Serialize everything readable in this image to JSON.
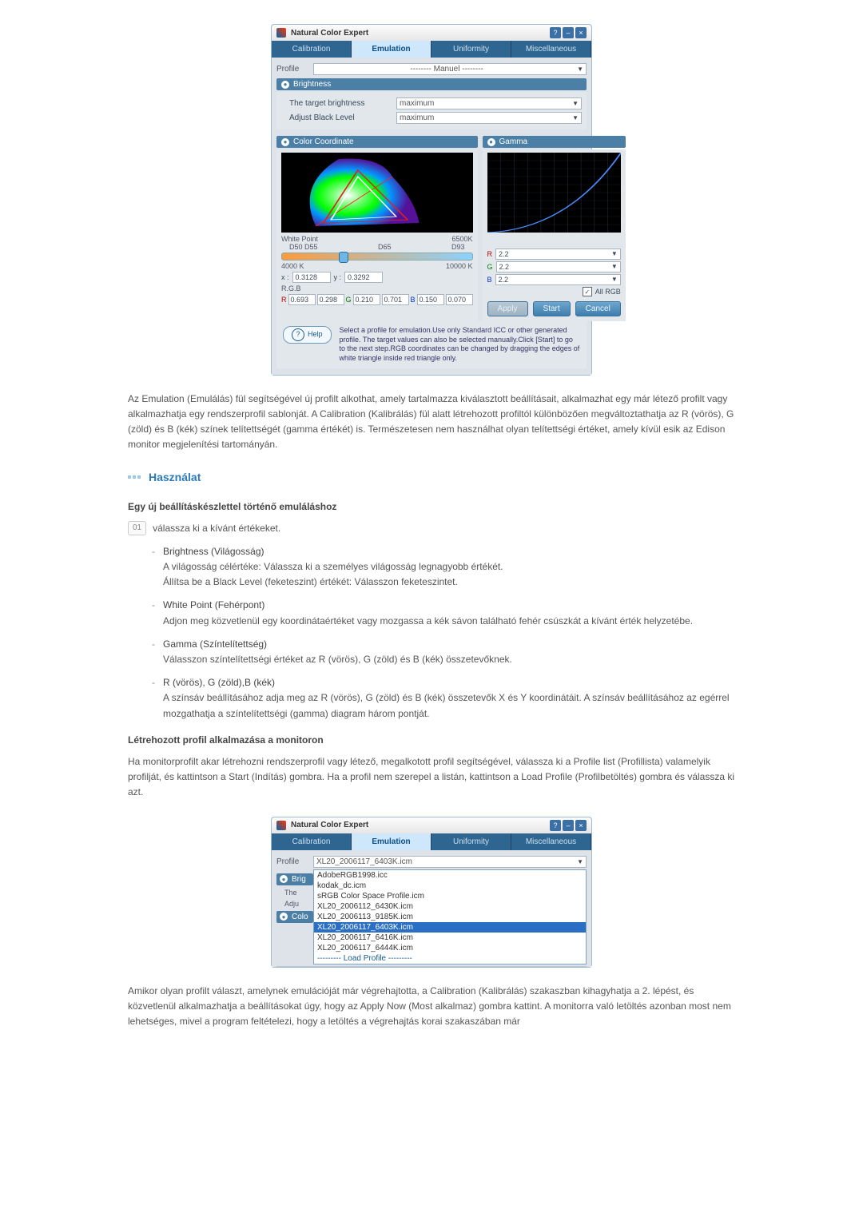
{
  "nce": {
    "title": "Natural Color Expert",
    "help_btn": "?",
    "min_btn": "–",
    "close_btn": "×",
    "tabs": {
      "calibration": "Calibration",
      "emulation": "Emulation",
      "uniformity": "Uniformity",
      "misc": "Miscellaneous"
    },
    "profile_label": "Profile",
    "profile_value": "-------- Manuel --------",
    "section_brightness": "Brightness",
    "target_brightness_label": "The target brightness",
    "target_brightness_value": "maximum",
    "adjust_black_label": "Adjust Black Level",
    "adjust_black_value": "maximum",
    "section_colorcoord": "Color Coordinate",
    "section_gamma": "Gamma",
    "white_point_label": "White Point",
    "white_point_value": "6500K",
    "slider_ticks": {
      "a": "D50 D55",
      "b": "D65",
      "c": "D93"
    },
    "slider_range": {
      "lo": "4000 K",
      "hi": "10000 K"
    },
    "xy": {
      "xlab": "x :",
      "x": "0.3128",
      "ylab": "y :",
      "y": "0.3292"
    },
    "rgb_label": "R.G.B",
    "rgb": {
      "rx": "0.693",
      "ry": "0.298",
      "gx": "0.210",
      "gy": "0.701",
      "bx": "0.150",
      "by": "0.070"
    },
    "gamma_sel": {
      "R": "R",
      "G": "G",
      "B": "B",
      "v": "2.2",
      "allrgb": "All RGB"
    },
    "buttons": {
      "apply": "Apply",
      "start": "Start",
      "cancel": "Cancel"
    },
    "help_label": "Help",
    "help_text": "Select a profile for emulation.Use only Standard ICC or other generated profile. The target values can also be selected manually.Click [Start] to go to the next step.RGB coordinates can be changed by dragging the edges of white triangle inside red triangle only."
  },
  "prose": {
    "p1": "Az Emulation (Emulálás) fül segítségével új profilt alkothat, amely tartalmazza kiválasztott beállításait, alkalmazhat egy már létező profilt vagy alkalmazhatja egy rendszerprofil sablonját. A Calibration (Kalibrálás) fül alatt létrehozott profiltól különbözően megváltoztathatja az R (vörös), G (zöld) és B (kék) színek telítettségét (gamma értékét) is. Természetesen nem használhat olyan telítettségi értéket, amely kívül esik az Edison monitor megjelenítési tartományán.",
    "section_title": "Használat",
    "sub1": "Egy új beállításkészlettel történő emuláláshoz",
    "step_num": "01",
    "step_text": "válassza ki a kívánt értékeket.",
    "items": [
      {
        "title": "Brightness (Világosság)",
        "l1": "A világosság célértéke: Válassza ki a személyes világosság legnagyobb értékét.",
        "l2": "Állítsa be a Black Level (feketeszint) értékét: Válasszon feketeszintet."
      },
      {
        "title": "White Point (Fehérpont)",
        "l1": "Adjon meg közvetlenül egy koordinátaértéket vagy mozgassa a kék sávon található fehér csúszkát a kívánt érték helyzetébe."
      },
      {
        "title": "Gamma (Színtelítettség)",
        "l1": "Válasszon színtelítettségi értéket az R (vörös), G (zöld) és B (kék) összetevőknek."
      },
      {
        "title": "R (vörös), G (zöld),B (kék)",
        "l1": "A színsáv beállításához adja meg az R (vörös), G (zöld) és B (kék) összetevők X és Y koordinátáit. A színsáv beállításához az egérrel mozgathatja a színtelítettségi (gamma) diagram három pontját."
      }
    ],
    "sub2": "Létrehozott profil alkalmazása a monitoron",
    "p2": "Ha monitorprofilt akar létrehozni rendszerprofil vagy létező, megalkotott profil segítségével, válassza ki a Profile list (Profillista) valamelyik profilját, és kattintson a Start (Indítás) gombra. Ha a profil nem szerepel a listán, kattintson a Load Profile (Profilbetöltés) gombra és válassza ki azt.",
    "p3": "Amikor olyan profilt választ, amelynek emulációját már végrehajtotta, a Calibration (Kalibrálás) szakaszban kihagyhatja a 2. lépést, és közvetlenül alkalmazhatja a beállításokat úgy, hogy az Apply Now (Most alkalmaz) gombra kattint. A monitorra való letöltés azonban most nem lehetséges, mivel a program feltételezi, hogy a letöltés a végrehajtás korai szakaszában már"
  },
  "nce2": {
    "profile_value": "XL20_2006117_6403K.icm",
    "section_brig": "Brig",
    "tgt_prefix": "The",
    "adj_prefix": "Adju",
    "trunc": "Colo",
    "options": [
      "AdobeRGB1998.icc",
      "kodak_dc.icm",
      "sRGB Color Space Profile.icm",
      "XL20_2006112_6430K.icm",
      "XL20_2006113_9185K.icm",
      "XL20_2006117_6403K.icm",
      "XL20_2006117_6416K.icm",
      "XL20_2006117_6444K.icm",
      "--------- Load Profile ---------"
    ]
  },
  "chart_data": {
    "type": "line",
    "title": "Gamma curve",
    "xlabel": "",
    "ylabel": "",
    "xlim": [
      0,
      1
    ],
    "ylim": [
      0,
      1
    ],
    "series": [
      {
        "name": "gamma 2.2",
        "x": [
          0,
          0.1,
          0.2,
          0.3,
          0.4,
          0.5,
          0.6,
          0.7,
          0.8,
          0.9,
          1.0
        ],
        "values": [
          0,
          0.006,
          0.029,
          0.071,
          0.133,
          0.218,
          0.325,
          0.457,
          0.612,
          0.793,
          1.0
        ]
      }
    ]
  }
}
